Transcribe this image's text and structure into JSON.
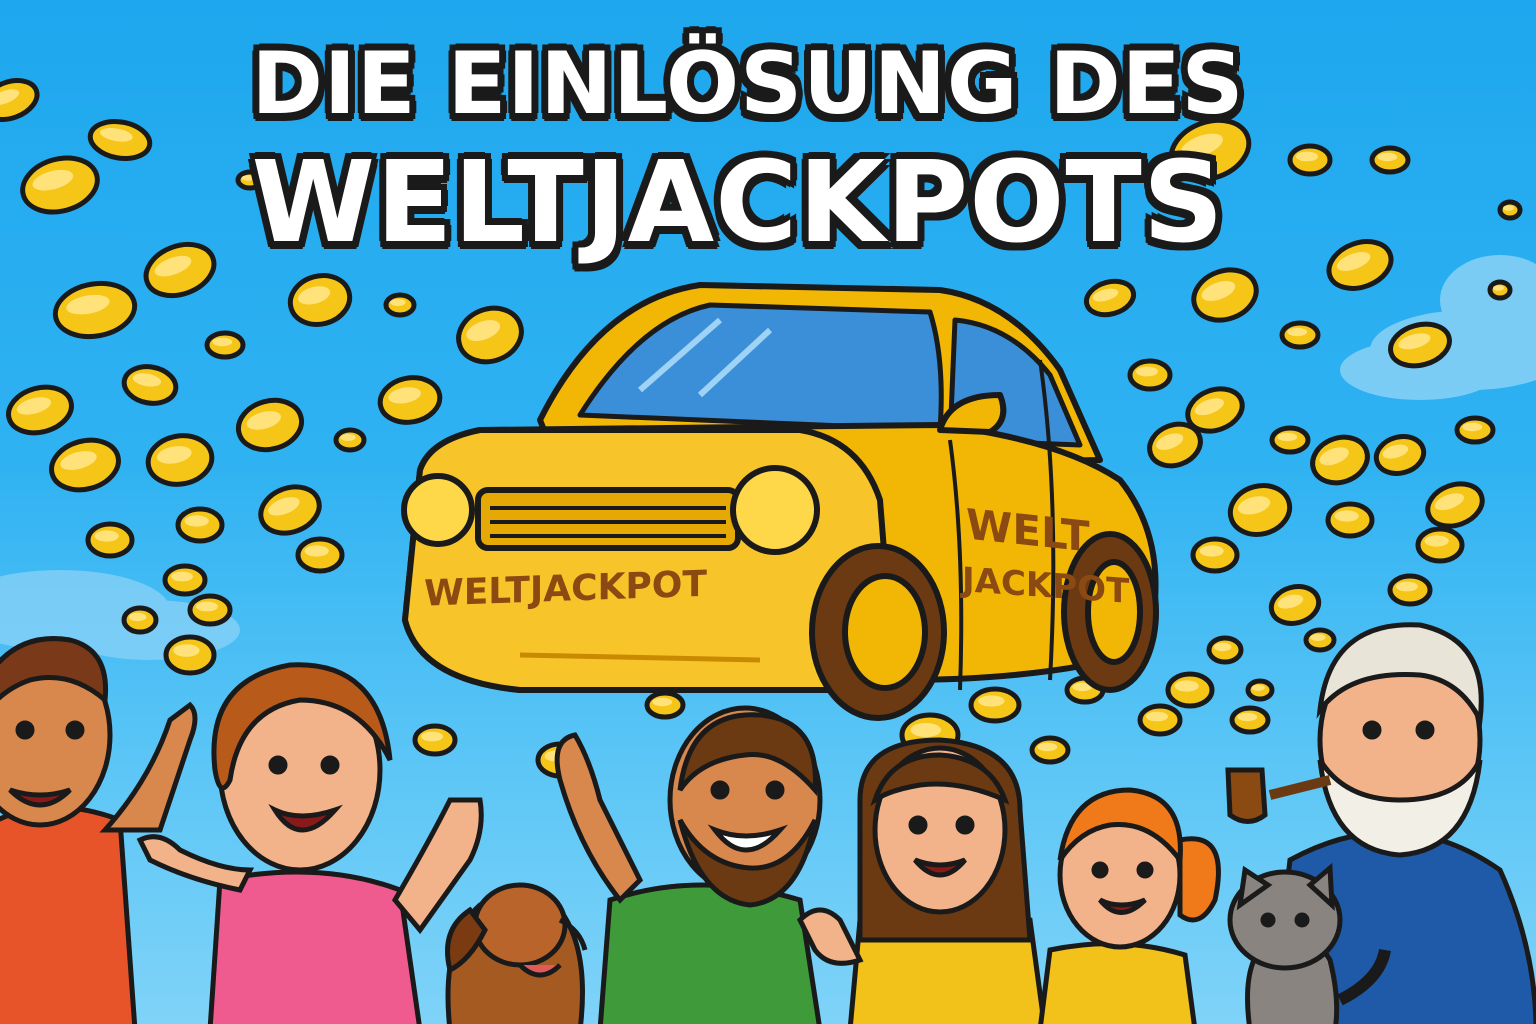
{
  "title": {
    "line1": "DIE EINLÖSUNG DES",
    "line2": "WELTJACKPOTS"
  },
  "car": {
    "front_label": "WELTJACKPOT",
    "door_label_line1": "WELT",
    "door_label_line2": "JACKPOT"
  },
  "colors": {
    "sky": "#2fb2f2",
    "coin": "#f5c518",
    "car_body": "#f2b705",
    "outline": "#1a1a1a",
    "car_text": "#8a4a12"
  },
  "scene": {
    "people": [
      "man-orange-shirt",
      "woman-pink-shirt",
      "man-green-shirt",
      "woman-yellow-shirt",
      "girl-yellow-shirt",
      "old-man-blue-sweater"
    ],
    "animals": [
      "dog-icon",
      "cat-icon"
    ]
  }
}
